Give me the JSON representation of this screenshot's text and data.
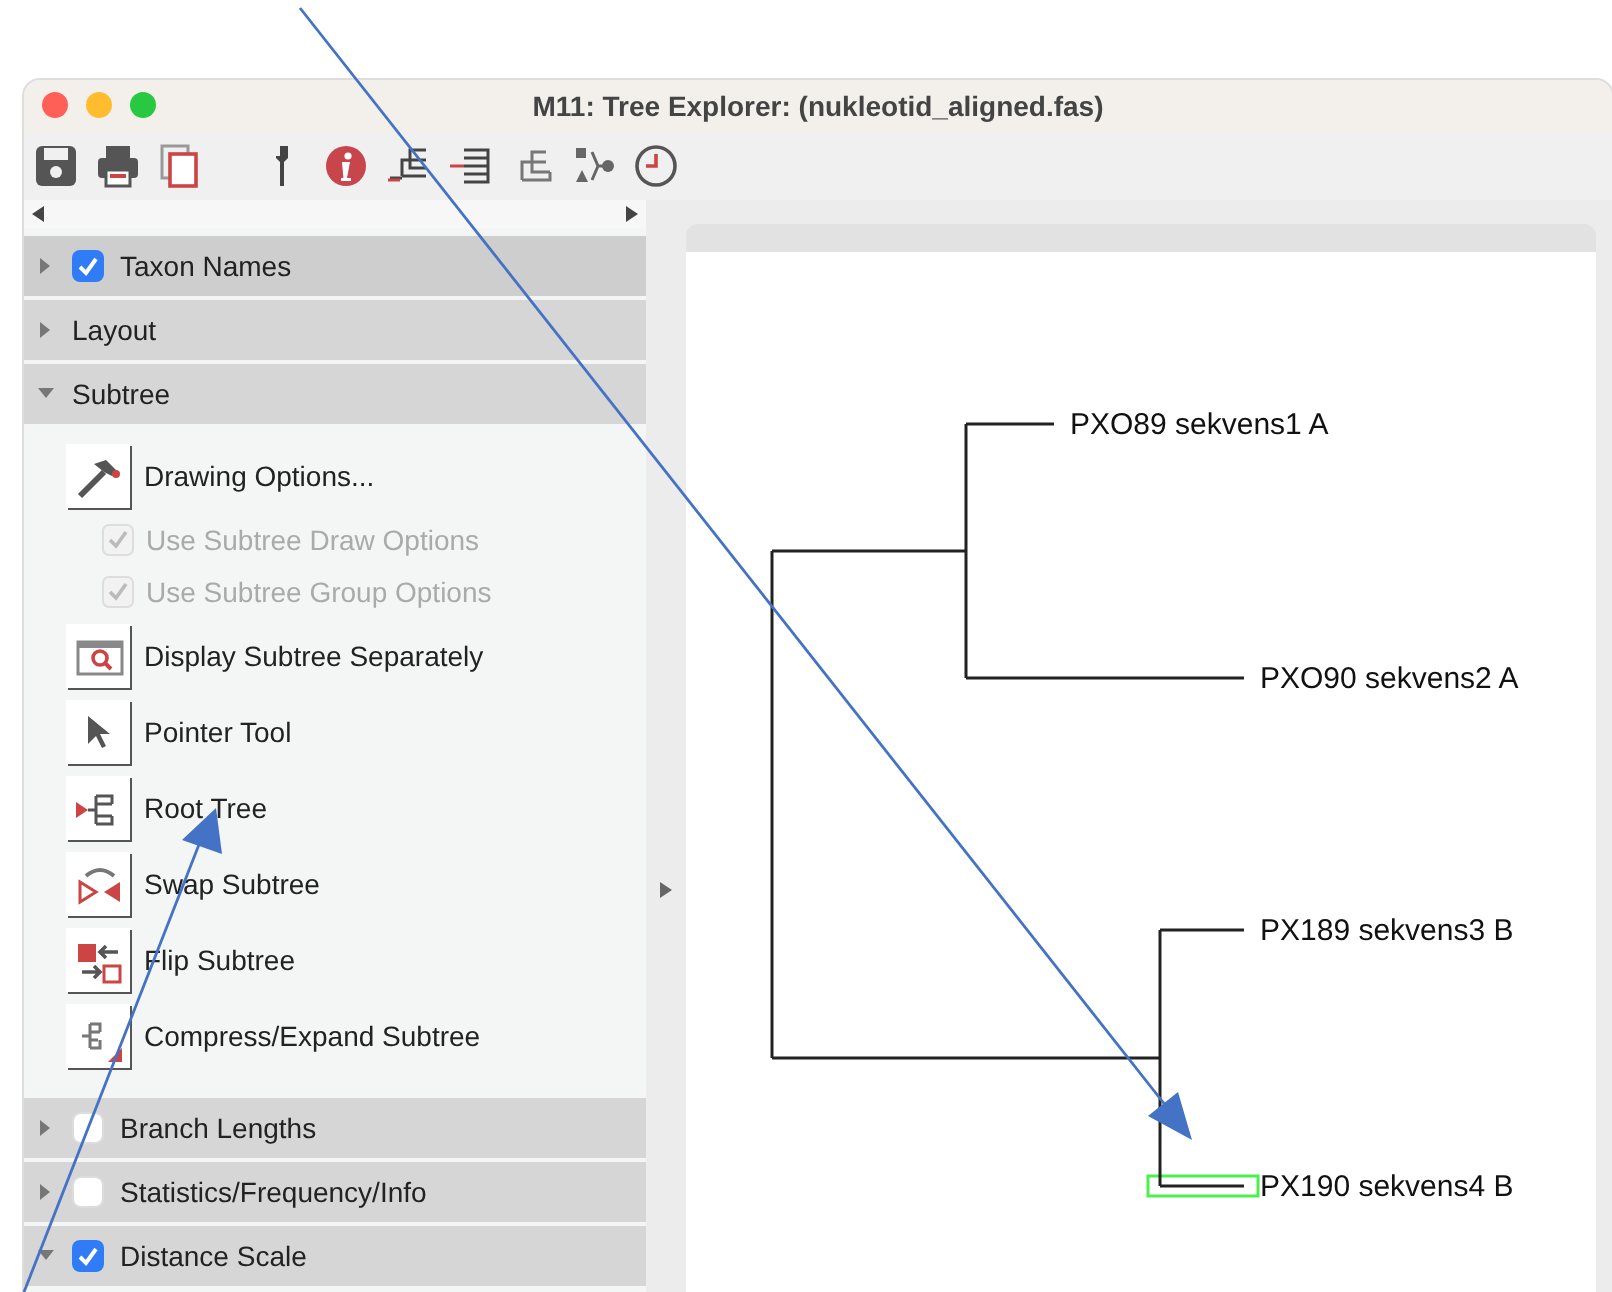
{
  "window": {
    "title": "M11: Tree Explorer: (nukleotid_aligned.fas)"
  },
  "sidebar": {
    "sections": [
      {
        "label": "Taxon Names",
        "kind": "checkbox",
        "checked": true,
        "expanded": false
      },
      {
        "label": "Layout",
        "kind": "plain",
        "expanded": false
      },
      {
        "label": "Subtree",
        "kind": "plain",
        "expanded": true,
        "items": [
          {
            "kind": "tool",
            "label": "Drawing Options..."
          },
          {
            "kind": "option",
            "label": "Use Subtree Draw Options",
            "checked": true,
            "disabled": true
          },
          {
            "kind": "option",
            "label": "Use Subtree Group Options",
            "checked": true,
            "disabled": true
          },
          {
            "kind": "tool",
            "label": "Display Subtree Separately"
          },
          {
            "kind": "tool",
            "label": "Pointer Tool"
          },
          {
            "kind": "tool",
            "label": "Root Tree"
          },
          {
            "kind": "tool",
            "label": "Swap Subtree"
          },
          {
            "kind": "tool",
            "label": "Flip Subtree"
          },
          {
            "kind": "tool",
            "label": "Compress/Expand Subtree"
          }
        ]
      },
      {
        "label": "Branch Lengths",
        "kind": "checkbox",
        "checked": false,
        "expanded": false
      },
      {
        "label": "Statistics/Frequency/Info",
        "kind": "checkbox",
        "checked": false,
        "expanded": false
      },
      {
        "label": "Distance Scale",
        "kind": "checkbox",
        "checked": true,
        "expanded": true
      }
    ]
  },
  "tree": {
    "children": [
      {
        "children": [
          {
            "label": "PXO89 sekvens1 A",
            "selected": false
          },
          {
            "label": "PXO90 sekvens2 A",
            "selected": false
          }
        ]
      },
      {
        "children": [
          {
            "label": "PX189 sekvens3 B",
            "selected": false
          },
          {
            "label": "PX190 sekvens4 B",
            "selected": true
          }
        ]
      }
    ]
  }
}
